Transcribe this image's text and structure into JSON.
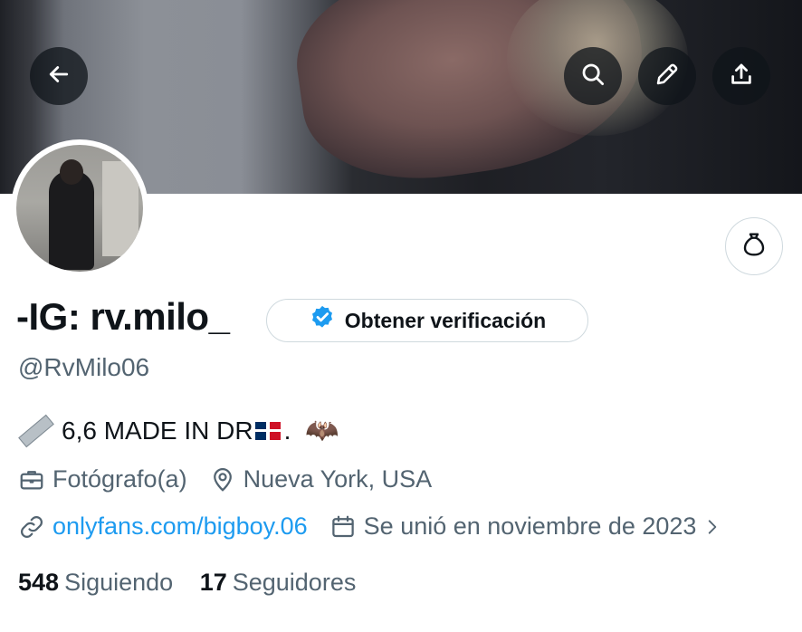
{
  "header": {
    "back_icon": "arrow-left-icon",
    "actions": [
      {
        "name": "search-button",
        "icon": "search-icon"
      },
      {
        "name": "edit-button",
        "icon": "pencil-icon"
      },
      {
        "name": "share-button",
        "icon": "share-icon"
      }
    ]
  },
  "profile": {
    "display_name": "-IG: rv.milo_",
    "handle": "@RvMilo06",
    "verify_label": "Obtener verificación",
    "bio_text": "6,6 MADE IN DR",
    "bio_tail": ".",
    "profession": "Fotógrafo(a)",
    "location": "Nueva York, USA",
    "website": "onlyfans.com/bigboy.06",
    "joined": "Se unió en noviembre de 2023",
    "following_count": "548",
    "following_label": "Siguiendo",
    "followers_count": "17",
    "followers_label": "Seguidores"
  },
  "colors": {
    "accent": "#1d9bf0",
    "muted": "#536471",
    "text": "#0f1419",
    "border": "#cfd9de"
  }
}
